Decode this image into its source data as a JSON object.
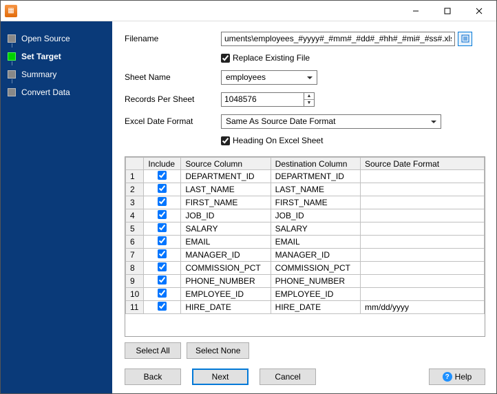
{
  "window": {
    "title": ""
  },
  "sidebar": {
    "items": [
      {
        "label": "Open Source",
        "active": false
      },
      {
        "label": "Set Target",
        "active": true
      },
      {
        "label": "Summary",
        "active": false
      },
      {
        "label": "Convert Data",
        "active": false
      }
    ]
  },
  "form": {
    "filename_label": "Filename",
    "filename_value": "uments\\employees_#yyyy#_#mm#_#dd#_#hh#_#mi#_#ss#.xlsx",
    "replace_existing_label": "Replace Existing File",
    "replace_existing_checked": true,
    "sheet_name_label": "Sheet Name",
    "sheet_name_value": "employees",
    "records_per_sheet_label": "Records Per Sheet",
    "records_per_sheet_value": "1048576",
    "excel_date_format_label": "Excel Date Format",
    "excel_date_format_value": "Same As Source Date Format",
    "heading_on_sheet_label": "Heading On Excel Sheet",
    "heading_on_sheet_checked": true
  },
  "grid": {
    "headers": {
      "include": "Include",
      "source_column": "Source Column",
      "destination_column": "Destination Column",
      "source_date_format": "Source Date Format"
    },
    "rows": [
      {
        "n": "1",
        "include": true,
        "source": "DEPARTMENT_ID",
        "dest": "DEPARTMENT_ID",
        "fmt": ""
      },
      {
        "n": "2",
        "include": true,
        "source": "LAST_NAME",
        "dest": "LAST_NAME",
        "fmt": ""
      },
      {
        "n": "3",
        "include": true,
        "source": "FIRST_NAME",
        "dest": "FIRST_NAME",
        "fmt": ""
      },
      {
        "n": "4",
        "include": true,
        "source": "JOB_ID",
        "dest": "JOB_ID",
        "fmt": ""
      },
      {
        "n": "5",
        "include": true,
        "source": "SALARY",
        "dest": "SALARY",
        "fmt": ""
      },
      {
        "n": "6",
        "include": true,
        "source": "EMAIL",
        "dest": "EMAIL",
        "fmt": ""
      },
      {
        "n": "7",
        "include": true,
        "source": "MANAGER_ID",
        "dest": "MANAGER_ID",
        "fmt": ""
      },
      {
        "n": "8",
        "include": true,
        "source": "COMMISSION_PCT",
        "dest": "COMMISSION_PCT",
        "fmt": ""
      },
      {
        "n": "9",
        "include": true,
        "source": "PHONE_NUMBER",
        "dest": "PHONE_NUMBER",
        "fmt": ""
      },
      {
        "n": "10",
        "include": true,
        "source": "EMPLOYEE_ID",
        "dest": "EMPLOYEE_ID",
        "fmt": ""
      },
      {
        "n": "11",
        "include": true,
        "source": "HIRE_DATE",
        "dest": "HIRE_DATE",
        "fmt": "mm/dd/yyyy"
      }
    ]
  },
  "buttons": {
    "select_all": "Select All",
    "select_none": "Select None",
    "back": "Back",
    "next": "Next",
    "cancel": "Cancel",
    "help": "Help"
  }
}
